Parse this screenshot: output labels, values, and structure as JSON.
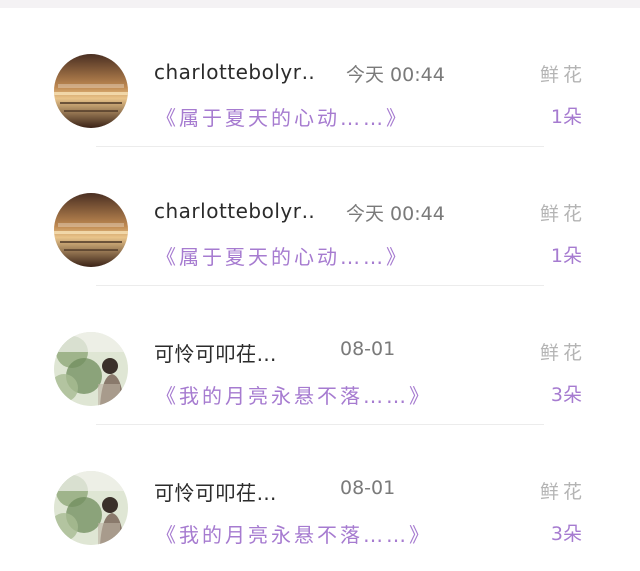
{
  "messages": [
    {
      "avatar_icon": "sunset-sea-avatar",
      "username": "charlottebolyr…",
      "time": "今天 00:44",
      "gift_type": "鲜花",
      "title": "《属于夏天的心动……》",
      "count": "1朵"
    },
    {
      "avatar_icon": "sunset-sea-avatar",
      "username": "charlottebolyr…",
      "time": "今天 00:44",
      "gift_type": "鲜花",
      "title": "《属于夏天的心动……》",
      "count": "1朵"
    },
    {
      "avatar_icon": "garden-girl-avatar",
      "username": "可怜可叩茌…",
      "time": "08-01",
      "gift_type": "鲜花",
      "title": "《我的月亮永悬不落……》",
      "count": "3朵"
    },
    {
      "avatar_icon": "garden-girl-avatar",
      "username": "可怜可叩茌…",
      "time": "08-01",
      "gift_type": "鲜花",
      "title": "《我的月亮永悬不落……》",
      "count": "3朵"
    }
  ],
  "colors": {
    "accent": "#a67bd0",
    "username": "#2b2b2b",
    "muted": "#b4b4b4"
  }
}
